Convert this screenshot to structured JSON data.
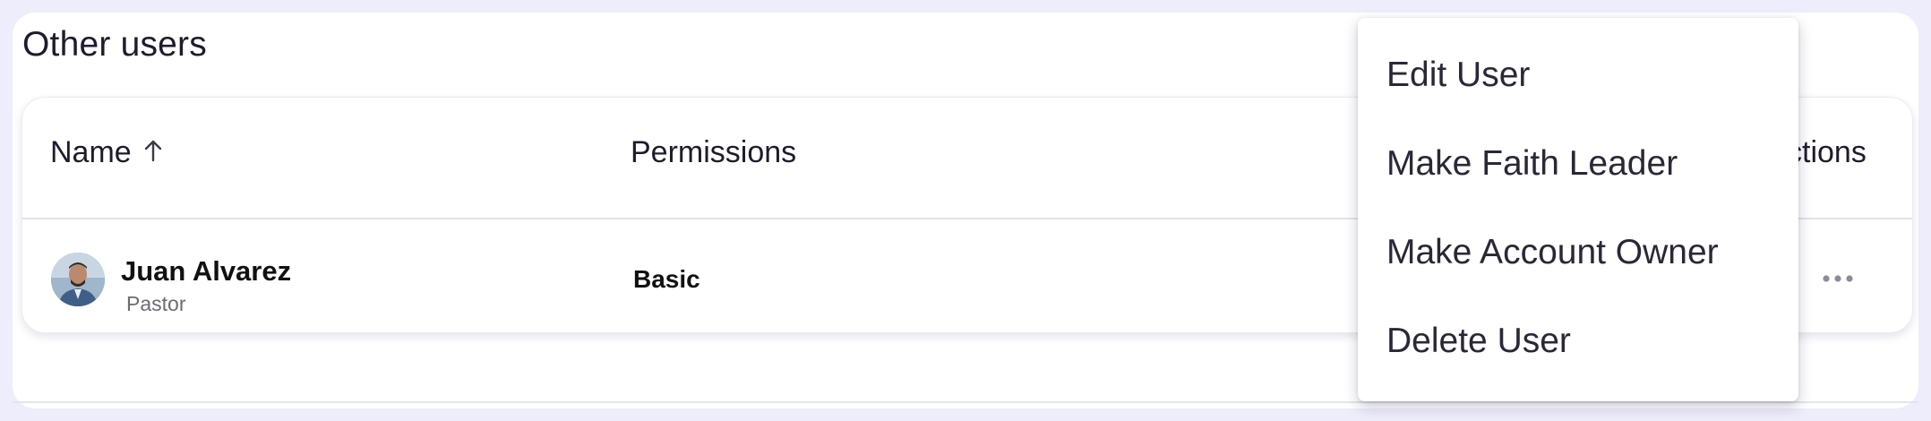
{
  "section": {
    "title": "Other users"
  },
  "table": {
    "columns": {
      "name": "Name",
      "permissions": "Permissions",
      "actions": "ctions"
    },
    "rows": [
      {
        "name": "Juan Alvarez",
        "role": "Pastor",
        "permission": "Basic"
      }
    ]
  },
  "menu": {
    "items": [
      "Edit User",
      "Make Faith Leader",
      "Make Account Owner",
      "Delete User"
    ]
  },
  "colors": {
    "background": "#eeedfb",
    "panel": "#ffffff",
    "text": "#1f1b2d"
  },
  "icons": {
    "sort": "arrow-up-icon",
    "more": "more-horizontal-icon"
  }
}
